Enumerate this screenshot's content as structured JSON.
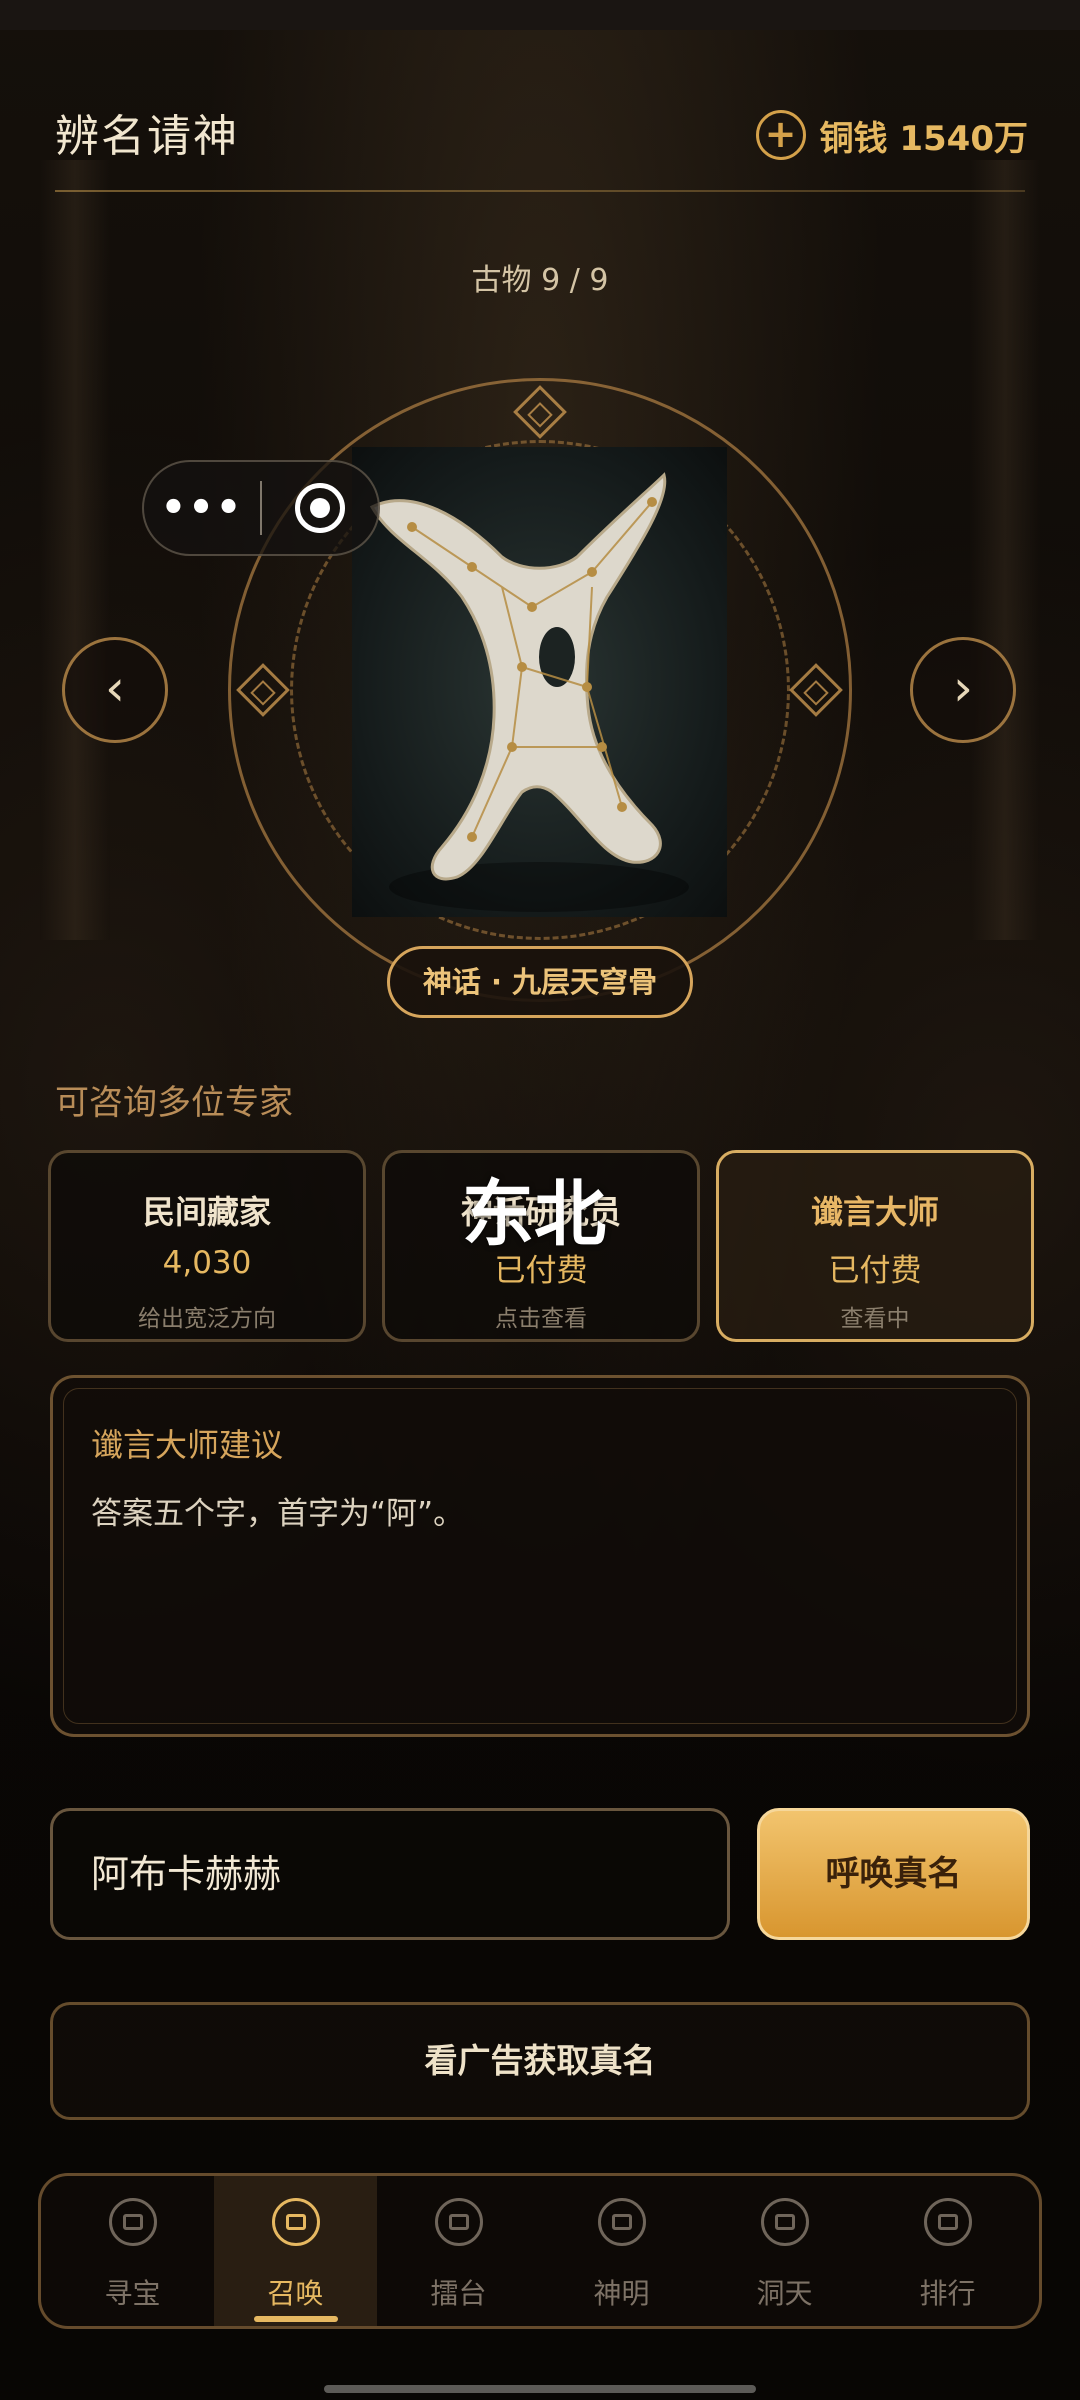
{
  "header": {
    "title": "辨名请神",
    "coins_label": "铜钱 1540万"
  },
  "relic": {
    "counter": "古物 9 / 9",
    "tag": "神话 · 九层天穹骨"
  },
  "capsule": {
    "more": "•••"
  },
  "nav": {
    "prev": "‹",
    "next": "›"
  },
  "experts": {
    "heading": "可咨询多位专家",
    "overlay": "东北",
    "cards": [
      {
        "title": "民间藏家",
        "value": "4,030",
        "desc": "给出宽泛方向"
      },
      {
        "title": "神话研究员",
        "value": "已付费",
        "desc": "点击查看"
      },
      {
        "title": "谶言大师",
        "value": "已付费",
        "desc": "查看中"
      }
    ]
  },
  "advice": {
    "title": "谶言大师建议",
    "text": "答案五个字，首字为“阿”。"
  },
  "answer": {
    "value": "阿布卡赫赫",
    "summon_label": "呼唤真名"
  },
  "ad": {
    "label": "看广告获取真名"
  },
  "tabs": [
    {
      "label": "寻宝",
      "icon": "treasure-icon"
    },
    {
      "label": "召唤",
      "icon": "summon-icon"
    },
    {
      "label": "擂台",
      "icon": "arena-icon"
    },
    {
      "label": "神明",
      "icon": "deity-icon"
    },
    {
      "label": "洞天",
      "icon": "grotto-icon"
    },
    {
      "label": "排行",
      "icon": "ranking-icon"
    }
  ],
  "colors": {
    "accent": "#e6b861",
    "gold_border": "#d6a55c",
    "background": "#0b0806"
  }
}
